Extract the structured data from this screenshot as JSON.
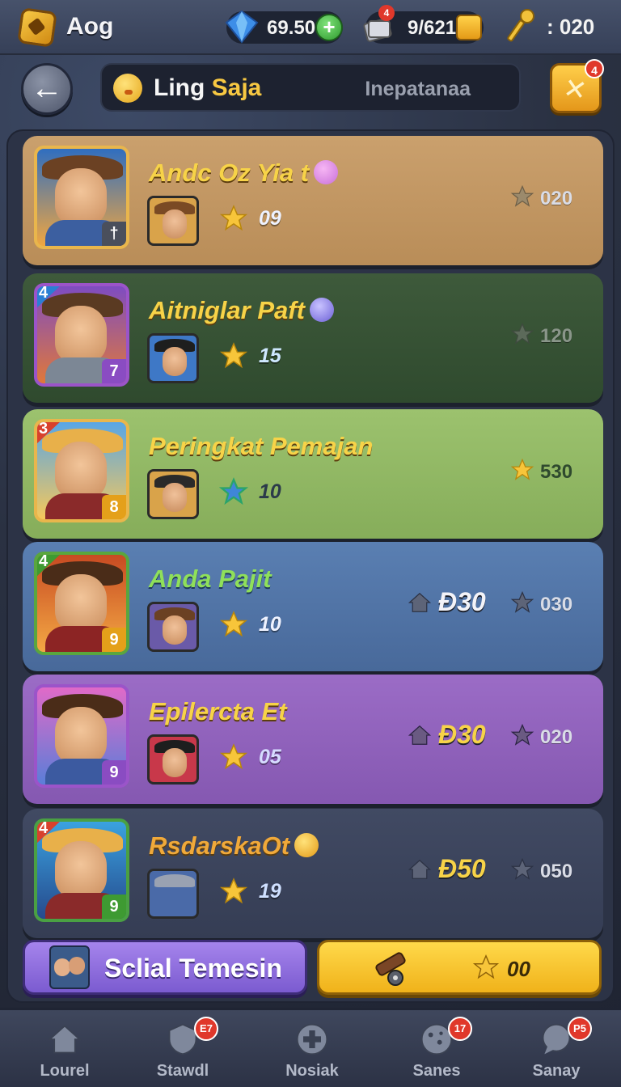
{
  "header": {
    "app_title": "Aog",
    "gems": "69.50",
    "cards": "9/621",
    "cards_badge": "4",
    "keys": ": 020"
  },
  "title_bar": {
    "title_word1": "Ling",
    "title_word2": "Saja",
    "subtitle": "Inepatanaa",
    "close_badge": "4"
  },
  "rows": [
    {
      "name": "Andc Oz Yia t",
      "rank": "",
      "level": "†",
      "score": "09",
      "right_value": "020",
      "coin_value": "",
      "gem_color": "#c86fd8",
      "accent": "#e9b64c"
    },
    {
      "name": "Aitniglar Paft",
      "rank": "4",
      "level": "7",
      "score": "15",
      "right_value": "120",
      "coin_value": "",
      "gem_color": "#7a6cdc",
      "accent": "#9b54c9"
    },
    {
      "name": "Peringkat Pemajan",
      "rank": "3",
      "level": "8",
      "score": "10",
      "right_value": "530",
      "coin_value": "",
      "gem_color": "",
      "accent": "#e9b64c"
    },
    {
      "name": "Anda Pajit",
      "rank": "4",
      "level": "9",
      "score": "10",
      "right_value": "030",
      "coin_value": "Ɖ30",
      "gem_color": "",
      "accent": "#5aa63e"
    },
    {
      "name": "Epilercta Et",
      "rank": "",
      "level": "9",
      "score": "05",
      "right_value": "020",
      "coin_value": "Ɖ30",
      "gem_color": "",
      "accent": "#9b54c9"
    },
    {
      "name": "RsdarskaOt",
      "rank": "4",
      "level": "9",
      "score": "19",
      "right_value": "050",
      "coin_value": "Ɖ50",
      "gem_color": "#f0b52a",
      "accent": "#4aa043"
    }
  ],
  "actions": {
    "social_label": "Sclial Temesin",
    "gold_value": "00"
  },
  "nav": [
    {
      "label": "Lourel",
      "badge": "",
      "icon": "home-icon"
    },
    {
      "label": "Stawdl",
      "badge": "E7",
      "icon": "shield-icon"
    },
    {
      "label": "Nosiak",
      "badge": "",
      "icon": "plus-circle-icon"
    },
    {
      "label": "Sanes",
      "badge": "17",
      "icon": "cookie-icon"
    },
    {
      "label": "Sanay",
      "badge": "P5",
      "icon": "chat-icon"
    }
  ],
  "colors": {
    "star_gold": "#f7c53a",
    "badge_red": "#e0382b"
  }
}
